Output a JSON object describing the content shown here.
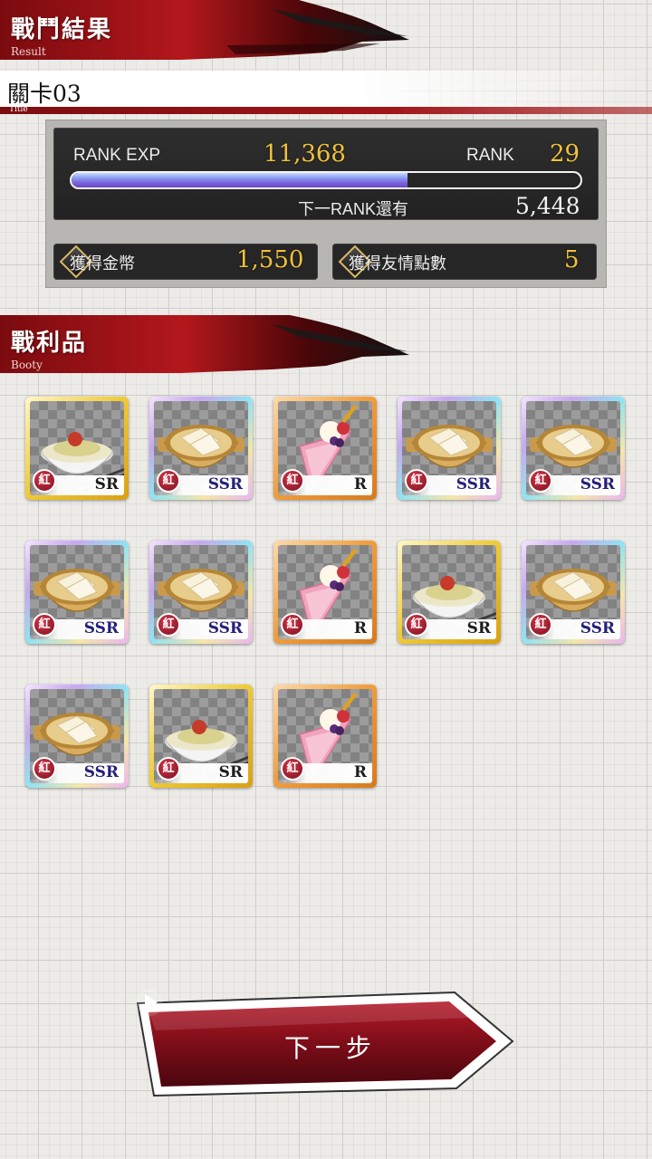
{
  "result_header": {
    "title": "戰鬥結果",
    "subtitle": "Result"
  },
  "stage": {
    "name": "關卡03",
    "sub_label": "Title"
  },
  "rank": {
    "exp_label": "RANK EXP",
    "exp_value": "11,368",
    "rank_label": "RANK",
    "rank_value": "29",
    "exp_progress_fraction": 0.66,
    "next_label": "下一RANK還有",
    "next_value": "5,448"
  },
  "rewards": {
    "coins_label": "獲得金幣",
    "coins_value": "1,550",
    "friend_label": "獲得友情點數",
    "friend_value": "5"
  },
  "booty_header": {
    "title": "戰利品",
    "subtitle": "Booty"
  },
  "booty_items": [
    {
      "dish": "bowl",
      "rarity": "SR",
      "badge": "紅"
    },
    {
      "dish": "pot",
      "rarity": "SSR",
      "badge": "紅"
    },
    {
      "dish": "crepe",
      "rarity": "R",
      "badge": "紅"
    },
    {
      "dish": "pot",
      "rarity": "SSR",
      "badge": "紅"
    },
    {
      "dish": "pot",
      "rarity": "SSR",
      "badge": "紅"
    },
    {
      "dish": "pot",
      "rarity": "SSR",
      "badge": "紅"
    },
    {
      "dish": "pot",
      "rarity": "SSR",
      "badge": "紅"
    },
    {
      "dish": "crepe",
      "rarity": "R",
      "badge": "紅"
    },
    {
      "dish": "bowl",
      "rarity": "SR",
      "badge": "紅"
    },
    {
      "dish": "pot",
      "rarity": "SSR",
      "badge": "紅"
    },
    {
      "dish": "pot",
      "rarity": "SSR",
      "badge": "紅"
    },
    {
      "dish": "bowl",
      "rarity": "SR",
      "badge": "紅"
    },
    {
      "dish": "crepe",
      "rarity": "R",
      "badge": "紅"
    }
  ],
  "next_button": {
    "label": "下一步",
    "icon": "play-arrow-icon"
  },
  "colors": {
    "accent_red": "#8e1013",
    "gold": "#f0c23a",
    "ssr_text": "#25207a"
  }
}
